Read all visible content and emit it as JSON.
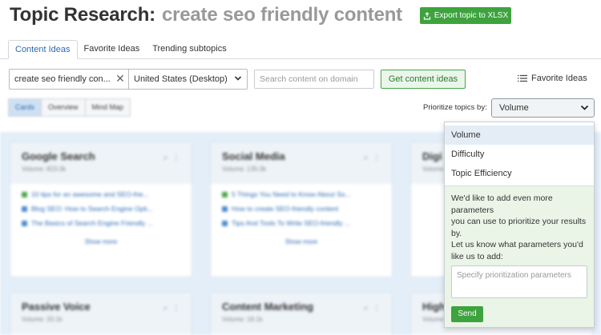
{
  "header": {
    "title": "Topic Research:",
    "query": "create seo friendly content",
    "export_label": "Export topic to XLSX"
  },
  "tabs": [
    {
      "label": "Content Ideas",
      "active": true
    },
    {
      "label": "Favorite Ideas",
      "active": false
    },
    {
      "label": "Trending subtopics",
      "active": false
    }
  ],
  "search": {
    "query_value": "create seo friendly con...",
    "region_value": "United States (Desktop)",
    "domain_placeholder": "Search content on domain",
    "get_ideas_label": "Get content ideas",
    "favorite_ideas_label": "Favorite Ideas"
  },
  "views": [
    {
      "label": "Cards",
      "active": true
    },
    {
      "label": "Overview",
      "active": false
    },
    {
      "label": "Mind Map",
      "active": false
    }
  ],
  "prioritize": {
    "label": "Prioritize topics by:",
    "selected": "Volume",
    "options": [
      "Volume",
      "Difficulty",
      "Topic Efficiency"
    ],
    "info_text": "We'd like to add even more parameters\nyou can use to prioritize your results by.\nLet us know what parameters you'd like us to add:",
    "textarea_placeholder": "Specify prioritization parameters",
    "send_label": "Send"
  },
  "cards": [
    {
      "title": "Google Search",
      "volume": "Volume: 823.0k",
      "lines": [
        "10 tips for an awesome and SEO-frie...",
        "Blog SEO: How to Search Engine Opti...",
        "The Basics of Search Engine Friendly ..."
      ],
      "show_more": "Show more"
    },
    {
      "title": "Social Media",
      "volume": "Volume: 135.0k",
      "lines": [
        "5 Things You Need to Know About So...",
        "How to create SEO-friendly content",
        "Tips And Tools To Write SEO-friendly ..."
      ],
      "show_more": "Show more"
    },
    {
      "title": "Digi",
      "volume": "Volume:",
      "lines": [
        "",
        "",
        ""
      ],
      "show_more": ""
    },
    {
      "title": "Passive Voice",
      "volume": "Volume: 33.1k",
      "lines": [],
      "show_more": ""
    },
    {
      "title": "Content Marketing",
      "volume": "Volume: 18.1k",
      "lines": [],
      "show_more": ""
    },
    {
      "title": "High",
      "volume": "Volume:",
      "lines": [],
      "show_more": ""
    }
  ],
  "colors": {
    "accent_green": "#3ea33e",
    "link_blue": "#2c6bb4",
    "board_bg": "#e3eef8",
    "info_bg": "#eaf5e8"
  }
}
